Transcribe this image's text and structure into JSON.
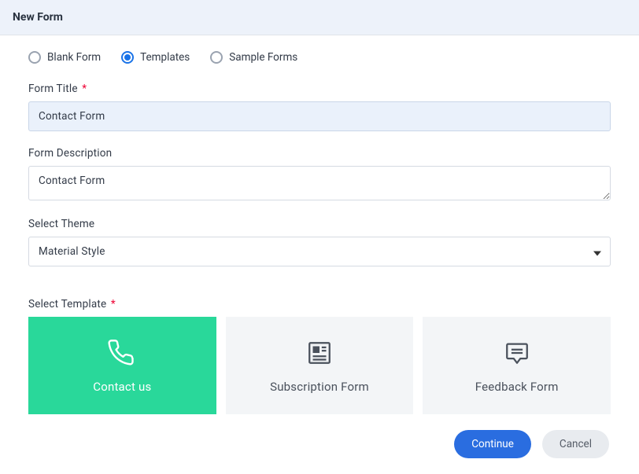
{
  "header": {
    "title": "New Form"
  },
  "sourceOptions": {
    "blank": "Blank Form",
    "templates": "Templates",
    "sample": "Sample Forms",
    "selected": "templates"
  },
  "fields": {
    "titleLabel": "Form Title",
    "titleValue": "Contact Form",
    "descLabel": "Form Description",
    "descValue": "Contact Form",
    "themeLabel": "Select Theme",
    "themeValue": "Material Style",
    "templateLabel": "Select Template"
  },
  "templates": [
    {
      "icon": "phone-icon",
      "label": "Contact us",
      "selected": true
    },
    {
      "icon": "newspaper-icon",
      "label": "Subscription Form",
      "selected": false
    },
    {
      "icon": "chat-icon",
      "label": "Feedback Form",
      "selected": false
    }
  ],
  "buttons": {
    "continue": "Continue",
    "cancel": "Cancel"
  }
}
